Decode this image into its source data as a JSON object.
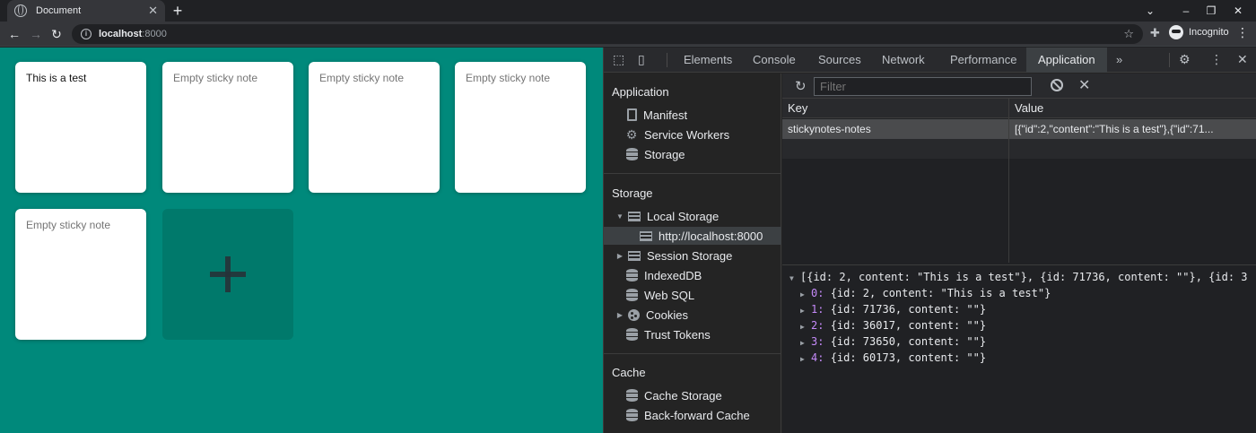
{
  "browser": {
    "tab_title": "Document",
    "tab_close": "✕",
    "new_tab": "+",
    "url_host": "localhost",
    "url_port": ":8000",
    "profile_label": "Incognito",
    "window_controls": [
      "⌄",
      "–",
      "❐",
      "✕"
    ]
  },
  "page": {
    "background_color": "#00897b",
    "notes": [
      {
        "text": "This is a test",
        "state": "filled"
      },
      {
        "text": "Empty sticky note",
        "state": "empty"
      },
      {
        "text": "Empty sticky note",
        "state": "empty"
      },
      {
        "text": "Empty sticky note",
        "state": "empty"
      },
      {
        "text": "Empty sticky note",
        "state": "empty"
      }
    ],
    "add_button_icon": "plus-icon"
  },
  "devtools": {
    "tabs": [
      "Elements",
      "Console",
      "Sources",
      "Network",
      "Performance",
      "Application"
    ],
    "active_tab": "Application",
    "more_tabs": "»",
    "sidebar": {
      "application_header": "Application",
      "application_items": [
        "Manifest",
        "Service Workers",
        "Storage"
      ],
      "storage_header": "Storage",
      "local_storage": "Local Storage",
      "local_storage_origin": "http://localhost:8000",
      "storage_items": [
        "Session Storage",
        "IndexedDB",
        "Web SQL",
        "Cookies",
        "Trust Tokens"
      ],
      "cache_header": "Cache",
      "cache_items": [
        "Cache Storage",
        "Back-forward Cache"
      ]
    },
    "filter_placeholder": "Filter",
    "table": {
      "key_header": "Key",
      "value_header": "Value",
      "rows": [
        {
          "key": "stickynotes-notes",
          "value": "[{\"id\":2,\"content\":\"This is a test\"},{\"id\":71..."
        }
      ]
    },
    "preview": {
      "summary": "[{id: 2, content: \"This is a test\"}, {id: 71736, content: \"\"}, {id: 3",
      "items": [
        {
          "index": "0:",
          "value": "{id: 2, content: \"This is a test\"}"
        },
        {
          "index": "1:",
          "value": "{id: 71736, content: \"\"}"
        },
        {
          "index": "2:",
          "value": "{id: 36017, content: \"\"}"
        },
        {
          "index": "3:",
          "value": "{id: 73650, content: \"\"}"
        },
        {
          "index": "4:",
          "value": "{id: 60173, content: \"\"}"
        }
      ]
    }
  }
}
